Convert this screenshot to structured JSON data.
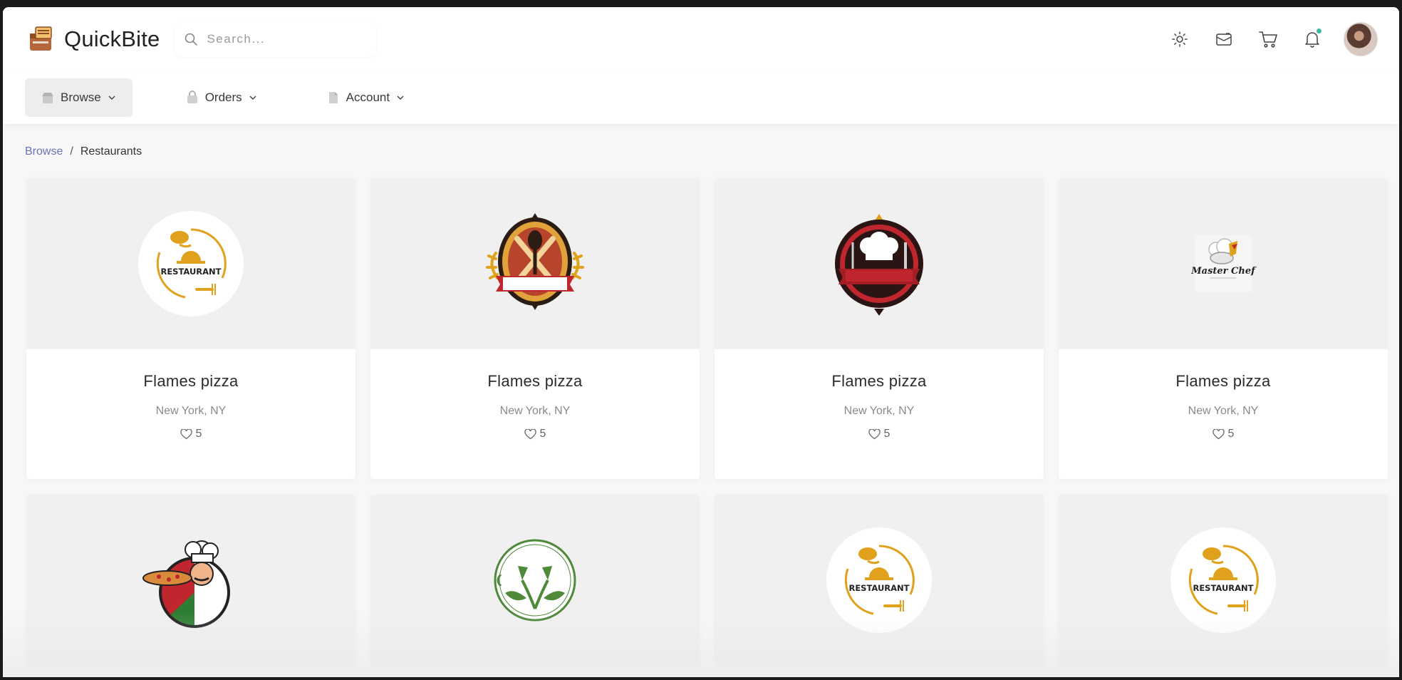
{
  "app": {
    "brand": "QuickBite"
  },
  "search": {
    "placeholder": "Search..."
  },
  "header_icons": [
    "sun-icon",
    "mail-icon",
    "cart-icon",
    "bell-icon"
  ],
  "nav": {
    "items": [
      {
        "label": "Browse",
        "active": true
      },
      {
        "label": "Orders",
        "active": false
      },
      {
        "label": "Account",
        "active": false
      }
    ]
  },
  "breadcrumb": {
    "parent": "Browse",
    "separator": "/",
    "current": "Restaurants"
  },
  "restaurants": [
    {
      "name": "Flames pizza",
      "location": "New York, NY",
      "likes": "5",
      "logo": "restaurant-cloche-logo",
      "logo_text": "RESTAURANT"
    },
    {
      "name": "Flames pizza",
      "location": "New York, NY",
      "likes": "5",
      "logo": "utensils-badge-logo"
    },
    {
      "name": "Flames pizza",
      "location": "New York, NY",
      "likes": "5",
      "logo": "chef-hat-badge-logo"
    },
    {
      "name": "Flames pizza",
      "location": "New York, NY",
      "likes": "5",
      "logo": "master-chef-logo",
      "logo_text": "Master Chef"
    },
    {
      "logo": "pizza-chef-logo"
    },
    {
      "logo": "green-leaf-utensils-logo"
    },
    {
      "logo": "restaurant-cloche-logo",
      "logo_text": "RESTAURANT"
    },
    {
      "logo": "restaurant-cloche-logo",
      "logo_text": "RESTAURANT"
    }
  ],
  "colors": {
    "accent_gold": "#e0a21c",
    "link": "#6a74b8",
    "badge_red": "#c0262d",
    "leaf_green": "#4e8a3a",
    "notification_dot": "#3fb8a8"
  }
}
